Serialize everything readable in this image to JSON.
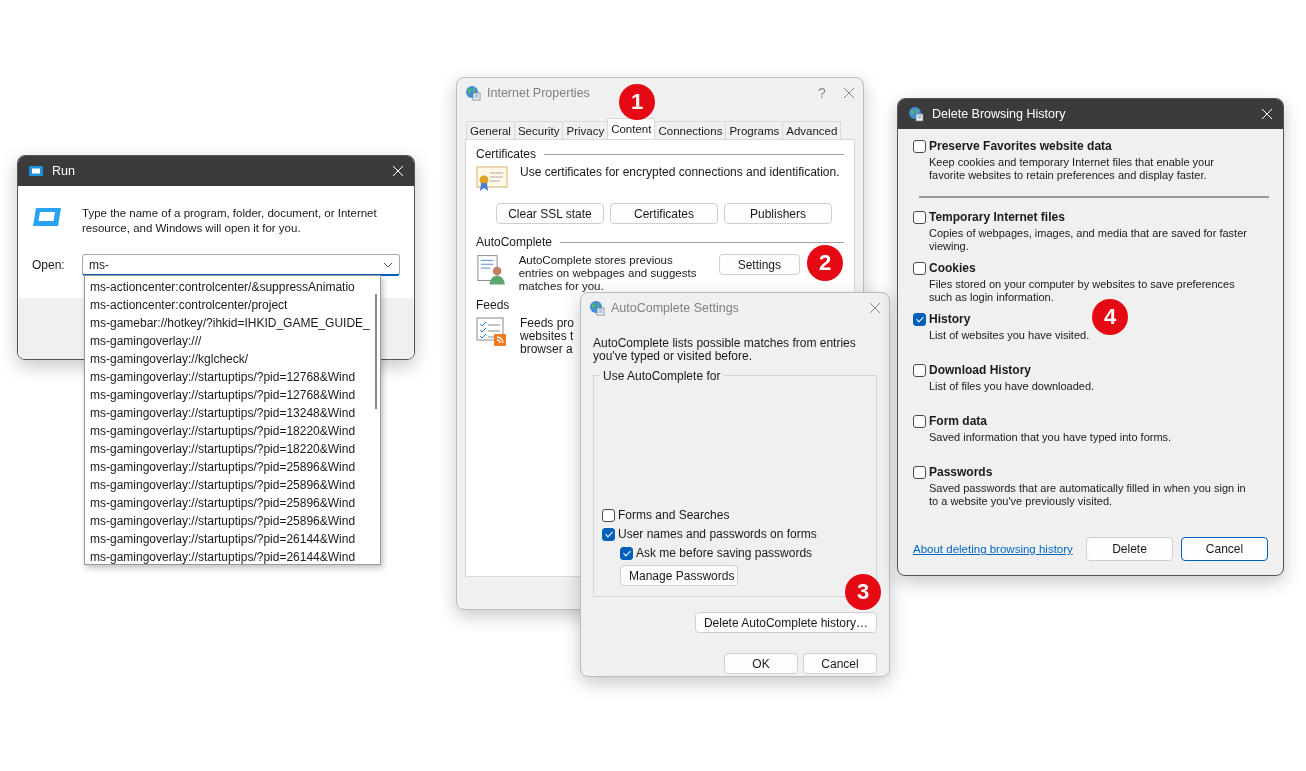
{
  "run_dialog": {
    "title": "Run",
    "prompt": "Type the name of a program, folder, document, or Internet resource, and Windows will open it for you.",
    "open_label": "Open:",
    "open_value": "ms-",
    "suggestions": [
      "ms-actioncenter:controlcenter/&suppressAnimatio",
      "ms-actioncenter:controlcenter/project",
      "ms-gamebar://hotkey/?ihkid=IHKID_GAME_GUIDE_",
      "ms-gamingoverlay:///",
      "ms-gamingoverlay://kglcheck/",
      "ms-gamingoverlay://startuptips/?pid=12768&Wind",
      "ms-gamingoverlay://startuptips/?pid=12768&Wind",
      "ms-gamingoverlay://startuptips/?pid=13248&Wind",
      "ms-gamingoverlay://startuptips/?pid=18220&Wind",
      "ms-gamingoverlay://startuptips/?pid=18220&Wind",
      "ms-gamingoverlay://startuptips/?pid=25896&Wind",
      "ms-gamingoverlay://startuptips/?pid=25896&Wind",
      "ms-gamingoverlay://startuptips/?pid=25896&Wind",
      "ms-gamingoverlay://startuptips/?pid=25896&Wind",
      "ms-gamingoverlay://startuptips/?pid=26144&Wind",
      "ms-gamingoverlay://startuptips/?pid=26144&Wind"
    ]
  },
  "internet_properties": {
    "title": "Internet Properties",
    "help_button": "?",
    "tabs": [
      {
        "label": "General",
        "selected": false
      },
      {
        "label": "Security",
        "selected": false
      },
      {
        "label": "Privacy",
        "selected": false
      },
      {
        "label": "Content",
        "selected": true
      },
      {
        "label": "Connections",
        "selected": false
      },
      {
        "label": "Programs",
        "selected": false
      },
      {
        "label": "Advanced",
        "selected": false
      }
    ],
    "certificates": {
      "heading": "Certificates",
      "text": "Use certificates for encrypted connections and identification.",
      "buttons": [
        "Clear SSL state",
        "Certificates",
        "Publishers"
      ]
    },
    "autocomplete": {
      "heading": "AutoComplete",
      "text": "AutoComplete stores previous entries on webpages and suggests matches for you.",
      "button": "Settings"
    },
    "feeds": {
      "heading": "Feeds",
      "text_lines": [
        "Feeds pro",
        "websites t",
        "browser a"
      ]
    }
  },
  "autocomplete_settings": {
    "title": "AutoComplete Settings",
    "intro": "AutoComplete lists possible matches from entries you've typed or visited before.",
    "group_label": "Use AutoComplete for",
    "options": [
      {
        "label": "Forms and Searches",
        "checked": false
      },
      {
        "label": "User names and passwords on forms",
        "checked": true,
        "children": [
          {
            "label": "Ask me before saving passwords",
            "checked": true
          }
        ]
      }
    ],
    "manage_button": "Manage Passwords",
    "delete_button": "Delete AutoComplete history…",
    "buttons": [
      "OK",
      "Cancel"
    ]
  },
  "delete_browsing_history": {
    "title": "Delete Browsing History",
    "preserve": {
      "label": "Preserve Favorites website data",
      "description": "Keep cookies and temporary Internet files that enable your favorite websites to retain preferences and display faster.",
      "checked": false
    },
    "items": [
      {
        "label": "Temporary Internet files",
        "description": "Copies of webpages, images, and media that are saved for faster viewing.",
        "checked": false
      },
      {
        "label": "Cookies",
        "description": "Files stored on your computer by websites to save preferences such as login information.",
        "checked": false
      },
      {
        "label": "History",
        "description": "List of websites you have visited.",
        "checked": true
      },
      {
        "label": "Download History",
        "description": "List of files you have downloaded.",
        "checked": false
      },
      {
        "label": "Form data",
        "description": "Saved information that you have typed into forms.",
        "checked": false
      },
      {
        "label": "Passwords",
        "description": "Saved passwords that are automatically filled in when you sign in to a website you've previously visited.",
        "checked": false
      }
    ],
    "link": "About deleting browsing history",
    "buttons": [
      {
        "label": "Delete",
        "default": false
      },
      {
        "label": "Cancel",
        "default": true
      }
    ]
  },
  "callouts": [
    "1",
    "2",
    "3",
    "4"
  ]
}
